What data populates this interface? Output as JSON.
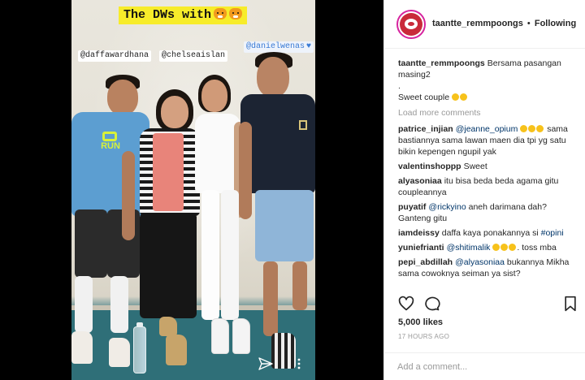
{
  "story": {
    "title": "The DWs with",
    "title_emojis": [
      "tiger-face",
      "tiger-face"
    ],
    "tags": {
      "left": "@daffawardhana",
      "middle": "@chelseaislan",
      "right": "@danielwenas"
    },
    "shirt_text": "RUN"
  },
  "post": {
    "username": "taantte_remmpoongs",
    "separator": "•",
    "follow_label": "Following",
    "caption_user": "taantte_remmpoongs",
    "caption_text": "Bersama pasangan masing2",
    "caption_dot": ".",
    "caption_line2": "Sweet couple",
    "load_more": "Load more comments",
    "comments": [
      {
        "user": "patrice_injian",
        "mention": "@jeanne_opium",
        "text": "sama bastiannya sama lawan maen dia tpi yg satu bikin kepengen ngupil yak"
      },
      {
        "user": "valentinshoppp",
        "mention": "",
        "text": "Sweet"
      },
      {
        "user": "alyasoniaa",
        "mention": "",
        "text": "itu bisa beda beda agama gitu coupleannya"
      },
      {
        "user": "puyatif",
        "mention": "@rickyino",
        "text": "aneh darimana dah? Ganteng gitu"
      },
      {
        "user": "iamdeissy",
        "mention": "",
        "text": "daffa kaya ponakannya si",
        "tail_mention": "#opini"
      },
      {
        "user": "yuniefrianti",
        "mention": "@shitimalik",
        "text": ". toss mba"
      },
      {
        "user": "pepi_abdillah",
        "mention": "@alyasoniaa",
        "text": "bukannya Mikha sama cowoknya seiman ya sist?"
      }
    ],
    "likes": "5,000 likes",
    "age": "17 HOURS AGO",
    "add_comment_placeholder": "Add a comment..."
  },
  "icons": {
    "like": "heart-outline-icon",
    "comment": "comment-bubble-icon",
    "save": "bookmark-icon",
    "send": "paper-plane-icon",
    "more": "vertical-dots-icon"
  },
  "colors": {
    "title_highlight": "#f7ec2a",
    "mention_blue": "#003569",
    "muted_gray": "#999999",
    "avatar_ring": "#d6249f",
    "floor_teal": "#2f6f78"
  }
}
